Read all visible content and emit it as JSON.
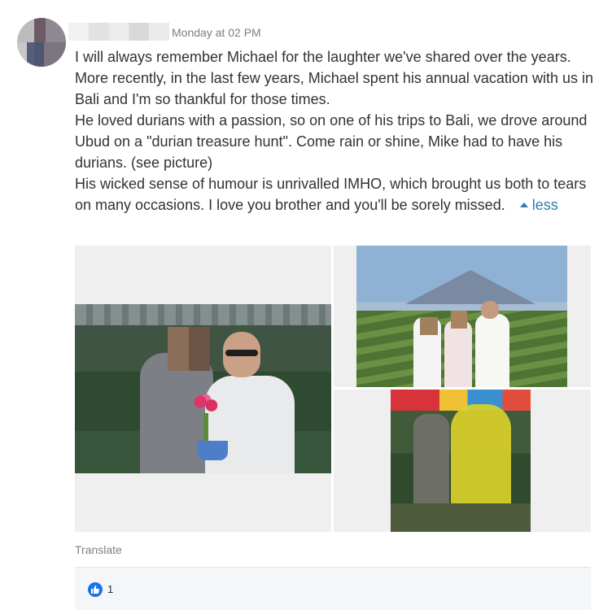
{
  "post": {
    "timestamp": "Monday at 02 PM",
    "paragraphs": [
      "I will always remember Michael for the laughter we've shared over the years. More recently, in the last few years, Michael spent his annual vacation with us in Bali and I'm so thankful for those times.",
      "He loved durians with a passion, so on one of his trips to Bali, we drove around Ubud on a \"durian treasure hunt\". Come rain or shine, Mike had to have his durians. (see picture)",
      "His wicked sense of humour is unrivalled IMHO, which brought us both to tears on many occasions. I love you brother and you'll be sorely missed."
    ],
    "less_label": "less",
    "translate_label": "Translate",
    "like_count": "1"
  },
  "colors": {
    "link": "#2a7fae",
    "like": "#1a73e8"
  }
}
